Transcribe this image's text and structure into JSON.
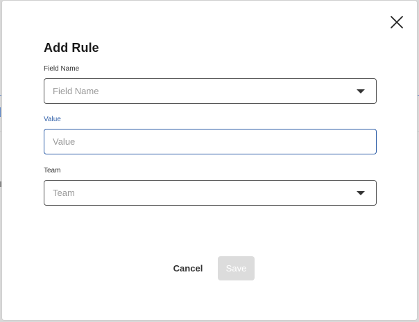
{
  "dialog": {
    "title": "Add Rule",
    "fields": [
      {
        "label": "Field Name",
        "placeholder": "Field Name",
        "type": "select",
        "active": false
      },
      {
        "label": "Value",
        "placeholder": "Value",
        "type": "text",
        "active": true
      },
      {
        "label": "Team",
        "placeholder": "Team",
        "type": "select",
        "active": false
      }
    ],
    "buttons": {
      "cancel_label": "Cancel",
      "save_label": "Save",
      "save_enabled": false
    }
  },
  "colors": {
    "accent": "#2f5fa8",
    "disabled_button": "#dcdcdc"
  },
  "icons": {
    "close": "close-icon",
    "dropdown": "chevron-down-icon"
  }
}
